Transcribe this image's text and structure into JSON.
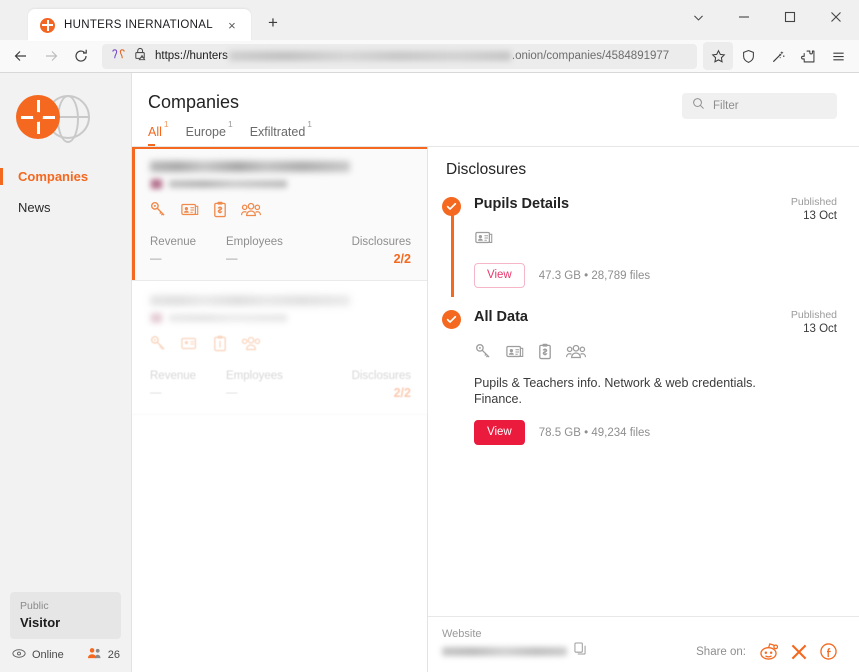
{
  "browser": {
    "tab": {
      "title": "HUNTERS INERNATIONAL",
      "favicon": "hunters-logo-icon",
      "close": "×"
    },
    "new_tab_label": "+",
    "window_controls": {
      "tab_list": "⌄",
      "minimize": "–",
      "maximize": "□",
      "close": "✕"
    },
    "nav": {
      "back": "back-arrow-icon",
      "forward": "forward-arrow-icon",
      "reload": "reload-icon"
    },
    "url": {
      "prefix": "https://hunters",
      "redacted": true,
      "suffix": ".onion/companies/4584891977"
    },
    "toolbar_icons": [
      "bookmark-star-icon",
      "shield-icon",
      "magic-wand-icon",
      "extensions-icon",
      "menu-icon"
    ]
  },
  "sidebar": {
    "logo_name": "hunters-international-logo",
    "items": [
      {
        "label": "Companies",
        "active": true
      },
      {
        "label": "News",
        "active": false
      }
    ],
    "user": {
      "role": "Public",
      "name": "Visitor"
    },
    "status": {
      "online_label": "Online",
      "visitors_count": "26"
    }
  },
  "main": {
    "title": "Companies",
    "tabs": [
      {
        "label": "All",
        "count": "1",
        "active": true
      },
      {
        "label": "Europe",
        "count": "1",
        "active": false
      },
      {
        "label": "Exfiltrated",
        "count": "1",
        "active": false
      }
    ],
    "filter": {
      "placeholder": "Filter",
      "value": ""
    }
  },
  "company_list": [
    {
      "name_redacted": true,
      "icons": [
        "key-icon",
        "id-card-icon",
        "finance-clipboard-icon",
        "people-icon"
      ],
      "revenue_label": "Revenue",
      "revenue_value": "—",
      "employees_label": "Employees",
      "employees_value": "—",
      "disclosures_label": "Disclosures",
      "disclosures_value": "2/2",
      "selected": true
    },
    {
      "name_redacted": true,
      "icons": [
        "key-icon",
        "id-card-icon",
        "finance-clipboard-icon",
        "people-icon"
      ],
      "revenue_label": "Revenue",
      "revenue_value": "—",
      "employees_label": "Employees",
      "employees_value": "—",
      "disclosures_label": "Disclosures",
      "disclosures_value": "2/2",
      "selected": false
    }
  ],
  "detail": {
    "title": "Disclosures",
    "disclosures": [
      {
        "name": "Pupils Details",
        "published_label": "Published",
        "published_date": "13 Oct",
        "icons": [
          "id-card-icon"
        ],
        "description": "",
        "view_label": "View",
        "size": "47.3 GB",
        "separator": "•",
        "files": "28,789 files",
        "button_style": "outline"
      },
      {
        "name": "All Data",
        "published_label": "Published",
        "published_date": "13 Oct",
        "icons": [
          "key-icon",
          "id-card-icon",
          "finance-clipboard-icon",
          "people-icon"
        ],
        "description": "Pupils & Teachers info. Network & web credentials. Finance.",
        "view_label": "View",
        "size": "78.5 GB",
        "separator": "•",
        "files": "49,234 files",
        "button_style": "solid"
      }
    ],
    "footer": {
      "website_label": "Website",
      "website_redacted": true,
      "copy_icon": "copy-icon",
      "share_label": "Share on:",
      "share_icons": [
        "reddit-icon",
        "x-twitter-icon",
        "facebook-icon"
      ]
    }
  },
  "colors": {
    "accent_orange": "#f4681f",
    "view_solid_red": "#ea1b3d",
    "view_outline_pink": "#e8386b"
  }
}
